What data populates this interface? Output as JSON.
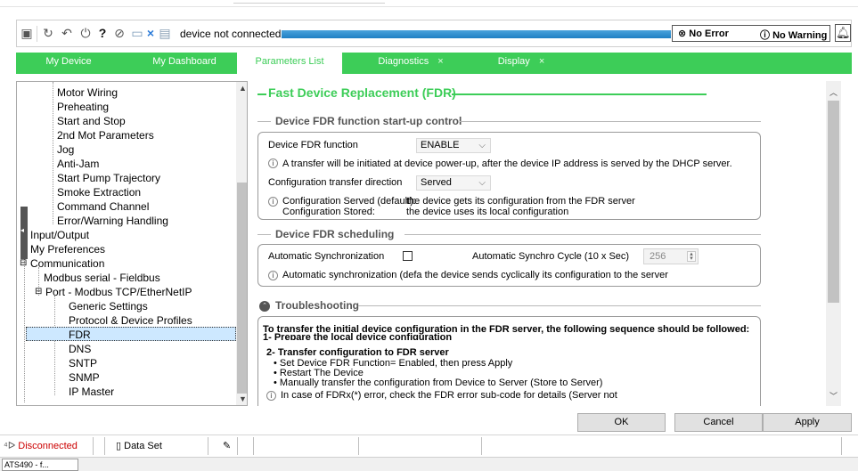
{
  "toolbar": {
    "status_text": "device not connected",
    "error_label": "No Error",
    "warning_label": "No Warning",
    "icons": [
      "device-icon",
      "refresh-icon",
      "undo-icon",
      "power-icon",
      "help-icon",
      "edit-icon",
      "monitor-icon",
      "disconnect-icon",
      "save-icon",
      "bell-icon"
    ]
  },
  "tabs": [
    {
      "label": "My Device"
    },
    {
      "label": "My Dashboard"
    },
    {
      "label": "Parameters List"
    },
    {
      "label": "Diagnostics",
      "close": "×"
    },
    {
      "label": "Display",
      "close": "×"
    }
  ],
  "tree": {
    "items": [
      "Motor Wiring",
      "Preheating",
      "Start and Stop",
      "2nd Mot Parameters",
      "Jog",
      "Anti-Jam",
      "Start Pump Trajectory",
      "Smoke Extraction",
      "Command Channel",
      "Error/Warning Handling",
      "Input/Output",
      "My Preferences",
      "Communication",
      "Modbus serial - Fieldbus",
      "Port - Modbus TCP/EtherNetIP",
      "Generic Settings",
      "Protocol & Device Profiles",
      "FDR",
      "DNS",
      "SNTP",
      "SNMP",
      "IP Master"
    ],
    "expanders": [
      "⊟",
      "⊟"
    ],
    "selected": "FDR"
  },
  "content": {
    "title": "Fast Device Replacement (FDR)",
    "startup": {
      "heading": "Device FDR function start-up control",
      "fdr_function_label": "Device FDR function",
      "fdr_function_value": "ENABLE",
      "info1": "A transfer will be initiated at device power-up, after the device IP address is served by the DHCP server.",
      "direction_label": "Configuration transfer direction",
      "direction_value": "Served",
      "served_label": "Configuration Served (default):",
      "served_desc": "the device gets its configuration from the FDR server",
      "stored_label": "Configuration Stored:",
      "stored_desc": "the device uses its local configuration"
    },
    "scheduling": {
      "heading": "Device FDR scheduling",
      "auto_sync_label": "Automatic Synchronization",
      "cycle_label": "Automatic Synchro Cycle (10 x Sec)",
      "cycle_value": "256",
      "info": "Automatic synchronization (defa the device sends cyclically its configuration to the server"
    },
    "troubleshooting": {
      "heading": "Troubleshooting",
      "intro": "To transfer the initial device configuration in the FDR server, the following sequence should be followed:",
      "step1": "1- Prepare the local device configuration",
      "step2": "2- Transfer configuration to FDR server",
      "bullets": [
        "• Set Device FDR Function= Enabled, then press Apply",
        "• Restart The Device",
        "• Manually transfer the configuration from Device to Server (Store to Server)"
      ],
      "info": "In case of FDRx(*) error, check the FDR error sub-code for details (Server not"
    }
  },
  "buttons": {
    "ok": "OK",
    "cancel": "Cancel",
    "apply": "Apply"
  },
  "statusbar": {
    "connection": "Disconnected",
    "dataset": "Data Set"
  },
  "taskbar": {
    "item": "ATS490 - f..."
  },
  "colors": {
    "accent_green": "#3dcd58",
    "progress_blue": "#1f7fc3",
    "disconnected_red": "#cc0000"
  }
}
